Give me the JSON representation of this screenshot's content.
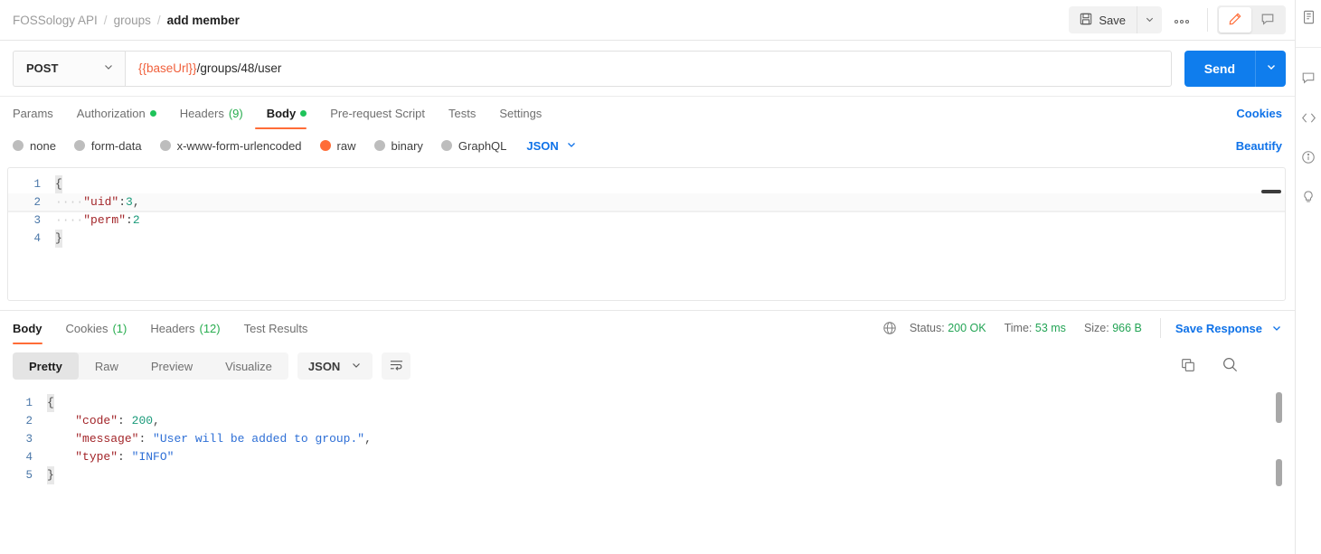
{
  "header": {
    "breadcrumb": {
      "collection": "FOSSology API",
      "folder": "groups",
      "request": "add member",
      "separator": "/"
    },
    "save_label": "Save",
    "save_icon": "floppy-disk-icon",
    "save_caret_icon": "chevron-down-icon",
    "more_actions_icon": "ellipsis-icon",
    "more_actions_label": "000",
    "edit_icon": "pencil-icon",
    "comment_icon": "comment-icon",
    "accent_color": "#ff6c37"
  },
  "request": {
    "method": "POST",
    "method_caret_icon": "chevron-down-icon",
    "url_variable": "{{baseUrl}}",
    "url_path": "/groups/48/user",
    "url_full": "{{baseUrl}}/groups/48/user",
    "send_label": "Send",
    "send_caret_icon": "chevron-down-icon",
    "send_color": "#0f7ded",
    "tabs": [
      {
        "label": "Params",
        "badge": "",
        "dot": false,
        "active": false
      },
      {
        "label": "Authorization",
        "badge": "",
        "dot": true,
        "active": false
      },
      {
        "label": "Headers",
        "badge": "(9)",
        "dot": false,
        "active": false
      },
      {
        "label": "Body",
        "badge": "",
        "dot": true,
        "active": true
      },
      {
        "label": "Pre-request Script",
        "badge": "",
        "dot": false,
        "active": false
      },
      {
        "label": "Tests",
        "badge": "",
        "dot": false,
        "active": false
      },
      {
        "label": "Settings",
        "badge": "",
        "dot": false,
        "active": false
      }
    ],
    "cookies_link": "Cookies",
    "beautify_link": "Beautify",
    "body_types": [
      {
        "label": "none",
        "selected": false
      },
      {
        "label": "form-data",
        "selected": false
      },
      {
        "label": "x-www-form-urlencoded",
        "selected": false
      },
      {
        "label": "raw",
        "selected": true
      },
      {
        "label": "binary",
        "selected": false
      },
      {
        "label": "GraphQL",
        "selected": false
      }
    ],
    "body_format": "JSON",
    "body_format_caret_icon": "chevron-down-icon",
    "body_lines": [
      {
        "n": "1",
        "indent": "",
        "text": "{",
        "kind": "brace",
        "highlight": false
      },
      {
        "n": "2",
        "indent": "····",
        "key": "\"uid\"",
        "sep": ":",
        "value": "3",
        "value_kind": "num",
        "trail": ",",
        "highlight": true
      },
      {
        "n": "3",
        "indent": "····",
        "key": "\"perm\"",
        "sep": ":",
        "value": "2",
        "value_kind": "num",
        "trail": "",
        "highlight": false
      },
      {
        "n": "4",
        "indent": "",
        "text": "}",
        "kind": "brace",
        "highlight": false
      }
    ]
  },
  "response": {
    "tabs": [
      {
        "label": "Body",
        "badge": "",
        "active": true
      },
      {
        "label": "Cookies",
        "badge": "(1)",
        "active": false
      },
      {
        "label": "Headers",
        "badge": "(12)",
        "active": false
      },
      {
        "label": "Test Results",
        "badge": "",
        "active": false
      }
    ],
    "network_icon": "globe-icon",
    "status_label": "Status:",
    "status_value": "200 OK",
    "time_label": "Time:",
    "time_value": "53 ms",
    "size_label": "Size:",
    "size_value": "966 B",
    "save_response_label": "Save Response",
    "save_response_caret_icon": "chevron-down-icon",
    "view_modes": [
      {
        "label": "Pretty",
        "active": true
      },
      {
        "label": "Raw",
        "active": false
      },
      {
        "label": "Preview",
        "active": false
      },
      {
        "label": "Visualize",
        "active": false
      }
    ],
    "format": "JSON",
    "format_caret_icon": "chevron-down-icon",
    "wrap_icon": "word-wrap-icon",
    "copy_icon": "copy-icon",
    "search_icon": "search-icon",
    "body_lines": [
      {
        "n": "1",
        "indent": "",
        "text": "{",
        "kind": "brace"
      },
      {
        "n": "2",
        "indent": "    ",
        "key": "\"code\"",
        "sep": ": ",
        "value": "200",
        "value_kind": "num",
        "trail": ","
      },
      {
        "n": "3",
        "indent": "    ",
        "key": "\"message\"",
        "sep": ": ",
        "value": "\"User will be added to group.\"",
        "value_kind": "str",
        "trail": ","
      },
      {
        "n": "4",
        "indent": "    ",
        "key": "\"type\"",
        "sep": ": ",
        "value": "\"INFO\"",
        "value_kind": "str",
        "trail": ""
      },
      {
        "n": "5",
        "indent": "",
        "text": "}",
        "kind": "brace"
      }
    ]
  },
  "rail": {
    "items": [
      {
        "icon": "documentation-icon"
      },
      {
        "icon": "comment-icon"
      },
      {
        "icon": "code-icon"
      },
      {
        "icon": "info-circle-icon"
      },
      {
        "icon": "lightbulb-icon"
      }
    ]
  }
}
